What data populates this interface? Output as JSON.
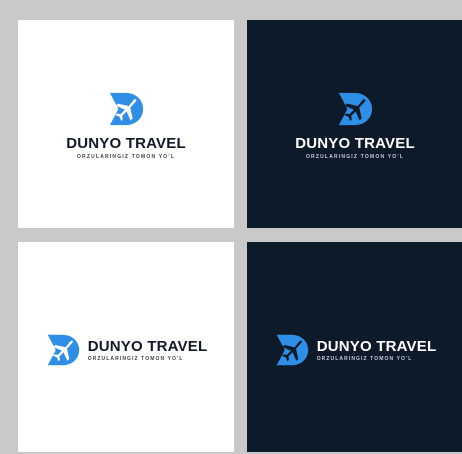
{
  "colors": {
    "accent": "#2f8fe6",
    "light_bg": "#ffffff",
    "dark_bg": "#0c1a2a",
    "frame_bg": "#c9c9c9"
  },
  "logos": [
    {
      "variant": "stacked",
      "theme": "light",
      "brand": "DUNYO TRAVEL",
      "tagline": "ORZULARINGIZ TOMON YO'L",
      "icon": "d-plane-icon"
    },
    {
      "variant": "stacked",
      "theme": "dark",
      "brand": "DUNYO TRAVEL",
      "tagline": "ORZULARINGIZ TOMON YO'L",
      "icon": "d-plane-icon"
    },
    {
      "variant": "horizontal",
      "theme": "light",
      "brand": "DUNYO TRAVEL",
      "tagline": "ORZULARINGIZ TOMON YO'L",
      "icon": "d-plane-icon"
    },
    {
      "variant": "horizontal",
      "theme": "dark",
      "brand": "DUNYO TRAVEL",
      "tagline": "ORZULARINGIZ TOMON YO'L",
      "icon": "d-plane-icon"
    }
  ]
}
